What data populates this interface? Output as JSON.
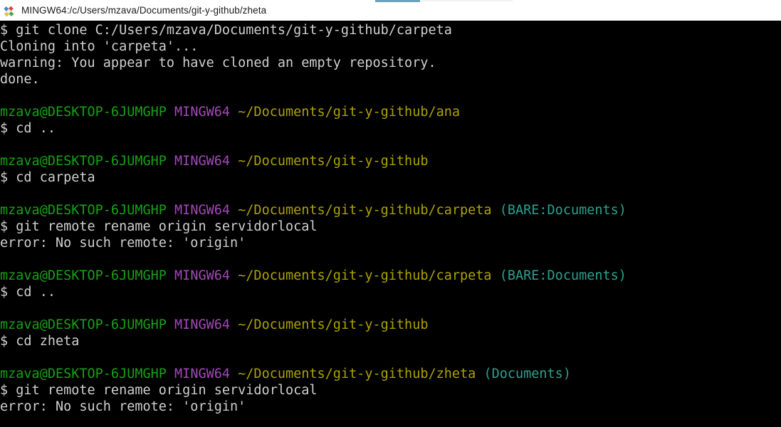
{
  "window": {
    "title": "MINGW64:/c/Users/mzava/Documents/git-y-github/zheta",
    "app_icon": "git-bash-icon",
    "background_color": "#000000",
    "foreground_color": "#cfcfcf",
    "titlebar_background": "#ffffff",
    "titlebar_foreground": "#1b1b1b"
  },
  "colors": {
    "user": "#17a117",
    "host": "#a347ba",
    "path": "#ada100",
    "repo": "#2ba18f",
    "text": "#cfcfcf",
    "tab_edge": "#6fa3b8"
  },
  "terminal": {
    "user_host": "mzava@DESKTOP-6JUMGHP",
    "shell_tag": "MINGW64",
    "prompt_symbol": "$",
    "lines": [
      {
        "type": "command",
        "prompt": "$ ",
        "text": "git clone C:/Users/mzava/Documents/git-y-github/carpeta"
      },
      {
        "type": "output",
        "text": "Cloning into 'carpeta'..."
      },
      {
        "type": "output",
        "text": "warning: You appear to have cloned an empty repository."
      },
      {
        "type": "output",
        "text": "done."
      },
      {
        "type": "blank",
        "text": ""
      },
      {
        "type": "prompt",
        "user": "mzava@DESKTOP-6JUMGHP",
        "host": "MINGW64",
        "path": "~/Documents/git-y-github/ana",
        "repo": ""
      },
      {
        "type": "command",
        "prompt": "$ ",
        "text": "cd .."
      },
      {
        "type": "blank",
        "text": ""
      },
      {
        "type": "prompt",
        "user": "mzava@DESKTOP-6JUMGHP",
        "host": "MINGW64",
        "path": "~/Documents/git-y-github",
        "repo": ""
      },
      {
        "type": "command",
        "prompt": "$ ",
        "text": "cd carpeta"
      },
      {
        "type": "blank",
        "text": ""
      },
      {
        "type": "prompt",
        "user": "mzava@DESKTOP-6JUMGHP",
        "host": "MINGW64",
        "path": "~/Documents/git-y-github/carpeta",
        "repo": "(BARE:Documents)"
      },
      {
        "type": "command",
        "prompt": "$ ",
        "text": "git remote rename origin servidorlocal"
      },
      {
        "type": "output",
        "text": "error: No such remote: 'origin'"
      },
      {
        "type": "blank",
        "text": ""
      },
      {
        "type": "prompt",
        "user": "mzava@DESKTOP-6JUMGHP",
        "host": "MINGW64",
        "path": "~/Documents/git-y-github/carpeta",
        "repo": "(BARE:Documents)"
      },
      {
        "type": "command",
        "prompt": "$ ",
        "text": "cd .."
      },
      {
        "type": "blank",
        "text": ""
      },
      {
        "type": "prompt",
        "user": "mzava@DESKTOP-6JUMGHP",
        "host": "MINGW64",
        "path": "~/Documents/git-y-github",
        "repo": ""
      },
      {
        "type": "command",
        "prompt": "$ ",
        "text": "cd zheta"
      },
      {
        "type": "blank",
        "text": ""
      },
      {
        "type": "prompt",
        "user": "mzava@DESKTOP-6JUMGHP",
        "host": "MINGW64",
        "path": "~/Documents/git-y-github/zheta",
        "repo": "(Documents)"
      },
      {
        "type": "command",
        "prompt": "$ ",
        "text": "git remote rename origin servidorlocal"
      },
      {
        "type": "output",
        "text": "error: No such remote: 'origin'"
      }
    ]
  }
}
